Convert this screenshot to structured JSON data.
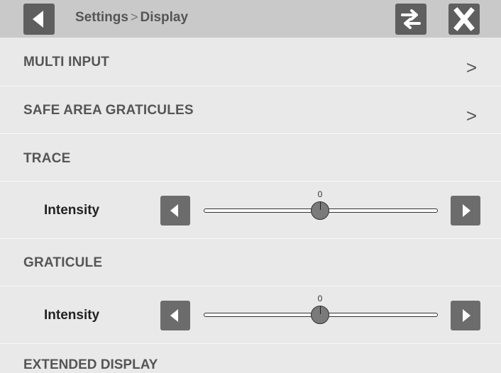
{
  "header": {
    "breadcrumb_parent": "Settings",
    "breadcrumb_separator": ">",
    "breadcrumb_current": "Display",
    "back_icon": "back-arrow-icon",
    "swap_icon": "swap-arrows-icon",
    "close_icon": "close-x-icon"
  },
  "menu": {
    "multi_input": "MULTI INPUT",
    "safe_area": "SAFE AREA GRATICULES",
    "trace": "TRACE",
    "graticule": "GRATICULE",
    "extended_display": "EXTENDED DISPLAY"
  },
  "chevron": ">",
  "trace_intensity": {
    "label": "Intensity",
    "value": "0",
    "position": 0.5
  },
  "graticule_intensity": {
    "label": "Intensity",
    "value": "0",
    "position": 0.5
  },
  "colors": {
    "header_bg": "#c9c9c9",
    "button_bg": "#5f5f5f",
    "panel_bg": "#e9e9e9"
  }
}
